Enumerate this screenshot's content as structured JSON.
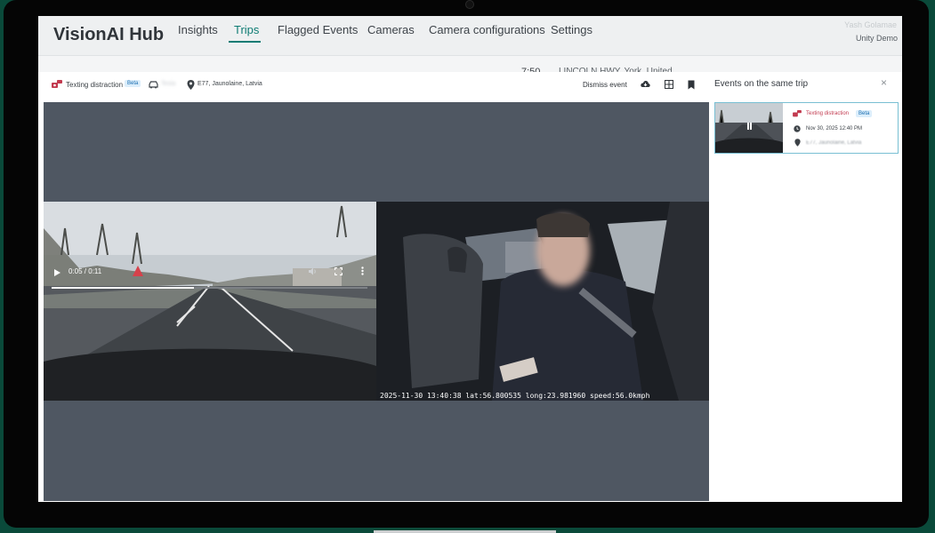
{
  "app": {
    "brand": "VisionAI Hub",
    "nav": [
      "Insights",
      "Trips",
      "Flagged Events",
      "Cameras",
      "Camera configurations",
      "Settings"
    ],
    "active_nav": "Trips",
    "user": {
      "name": "Yash Golamae",
      "org": "Unity Demo"
    }
  },
  "background_row": {
    "time": "7:50",
    "location": "LINCOLN HWY, York, United"
  },
  "event": {
    "type": "Texting distraction",
    "beta": "Beta",
    "vehicle": "Tesla",
    "location": "E77, Jaunolaine, Latvia",
    "dismiss_label": "Dismiss event"
  },
  "player": {
    "time": "0:05 / 0:11",
    "progress": 0.45,
    "overlay": "2025-11-30 13:40:38 lat:56.800535 long:23.981960 speed:56.0kmph"
  },
  "side_panel": {
    "title": "Events on the same trip",
    "close": "×",
    "card": {
      "event_type": "Texting distraction",
      "beta": "Beta",
      "datetime": "Nov 30, 2025 12:40 PM",
      "location": "E77, Jaunolaine, Latvia"
    }
  },
  "icons": {
    "event": "texting-distraction-icon",
    "vehicle": "car-icon",
    "location": "location-pin-icon",
    "download": "download-icon",
    "layout": "grid-layout-icon",
    "bookmark": "bookmark-icon",
    "clock": "clock-icon",
    "play": "play-icon",
    "volume": "volume-icon",
    "fullscreen": "fullscreen-icon",
    "more": "more-vertical-icon",
    "pause": "pause-icon",
    "close": "close-icon"
  },
  "colors": {
    "accent": "#0f7c74",
    "event_red": "#c23a4f",
    "beta_blue": "#1c6fb2",
    "player_bg": "#4f5762"
  }
}
